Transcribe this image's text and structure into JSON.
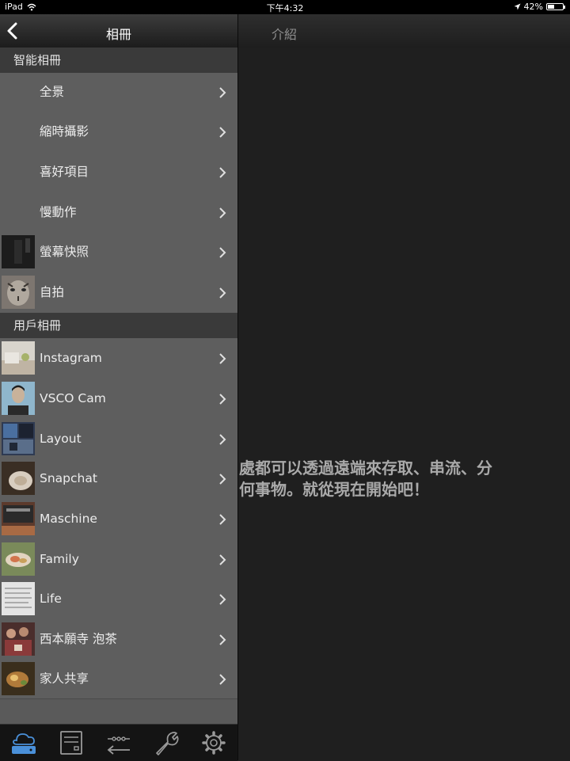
{
  "status_bar": {
    "device": "iPad",
    "time": "下午4:32",
    "battery": "42%",
    "battery_level": 0.42
  },
  "left_panel": {
    "title": "相冊",
    "sections": [
      {
        "title": "智能相冊",
        "items": [
          {
            "label": "全景",
            "thumb": null
          },
          {
            "label": "縮時攝影",
            "thumb": null
          },
          {
            "label": "喜好項目",
            "thumb": null
          },
          {
            "label": "慢動作",
            "thumb": null
          },
          {
            "label": "螢幕快照",
            "thumb": "#2a2a2a"
          },
          {
            "label": "自拍",
            "thumb": "#9a9590"
          }
        ]
      },
      {
        "title": "用戶相冊",
        "items": [
          {
            "label": "Instagram",
            "thumb": "#c7c2b8"
          },
          {
            "label": "VSCO Cam",
            "thumb": "#7fa3b8"
          },
          {
            "label": "Layout",
            "thumb": "#3c4a66"
          },
          {
            "label": "Snapchat",
            "thumb": "#7a6a58"
          },
          {
            "label": "Maschine",
            "thumb": "#6b4a3a"
          },
          {
            "label": "Family",
            "thumb": "#8a9a6a"
          },
          {
            "label": "Life",
            "thumb": "#d9d9d9"
          },
          {
            "label": "西本願寺 泡茶",
            "thumb": "#7a4a48"
          },
          {
            "label": "家人共享",
            "thumb": "#5a4a30"
          }
        ]
      }
    ]
  },
  "tabbar": {
    "tabs": [
      {
        "icon": "cloud-storage-icon",
        "active": true
      },
      {
        "icon": "server-icon",
        "active": false
      },
      {
        "icon": "transfer-icon",
        "active": false
      },
      {
        "icon": "wrench-icon",
        "active": false
      },
      {
        "icon": "gear-icon",
        "active": false
      }
    ]
  },
  "right_panel": {
    "title": "介紹",
    "intro_line1": "處都可以透過遠端來存取、串流、分",
    "intro_line2": "何事物。就從現在開始吧！"
  },
  "colors": {
    "accent": "#4a90d9",
    "section_bg": "#3a3a3a",
    "list_bg": "#5e5e5e"
  }
}
